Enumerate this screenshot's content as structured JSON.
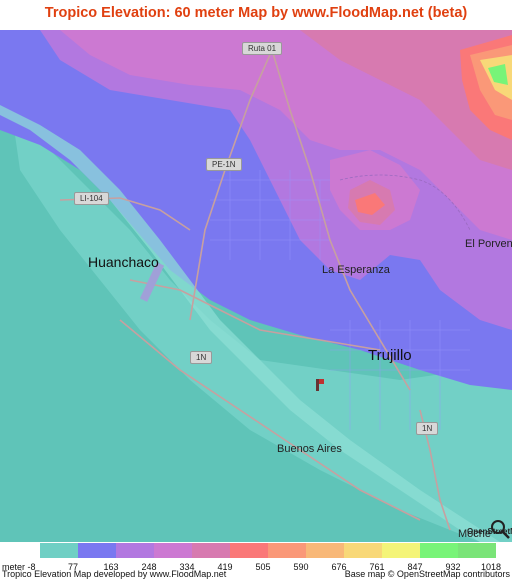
{
  "title": "Tropico Elevation: 60 meter Map by www.FloodMap.net (beta)",
  "map": {
    "places": {
      "huanchaco": "Huanchaco",
      "la_esperanza": "La Esperanza",
      "trujillo": "Trujillo",
      "buenos_aires": "Buenos Aires",
      "el_porvenir": "El Porven",
      "moche": "Moche"
    },
    "road_shields": {
      "ruta01": "Ruta 01",
      "pe1n": "PE-1N",
      "li104": "LI-104",
      "r1n_a": "1N",
      "r1n_b": "1N"
    },
    "marker_icon": "location-pin-icon",
    "attribution_mark": "OpenStreetMap"
  },
  "legend": {
    "unit_label": "meter",
    "min_label": "-8",
    "ticks": [
      "77",
      "163",
      "248",
      "334",
      "419",
      "505",
      "590",
      "676",
      "761",
      "847",
      "932",
      "1018"
    ],
    "colors": [
      "#6fcfc4",
      "#7a78f0",
      "#b278e0",
      "#cc79d2",
      "#d77ab0",
      "#fa7878",
      "#fa9878",
      "#f8b878",
      "#f8d878",
      "#f4f478",
      "#78f478",
      "#7ae478"
    ]
  },
  "footer": {
    "left": "Tropico Elevation Map developed by www.FloodMap.net",
    "right": "Base map © OpenStreetMap contributors"
  }
}
